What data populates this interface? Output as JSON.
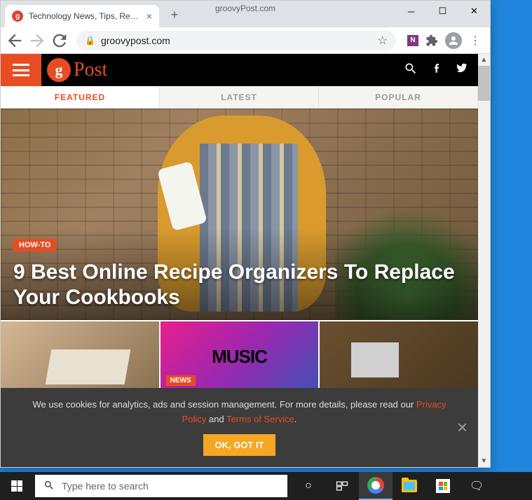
{
  "browser": {
    "tab_title": "Technology News, Tips, Reviews,",
    "overlay": "groovyPost.com",
    "url": "groovypost.com"
  },
  "site": {
    "logo_letter": "g",
    "logo_text": "Post"
  },
  "nav_tabs": {
    "featured": "FEATURED",
    "latest": "LATEST",
    "popular": "POPULAR"
  },
  "hero": {
    "category": "HOW-TO",
    "title": "9 Best Online Recipe Organizers To Replace Your Cookbooks"
  },
  "thumbs": {
    "news_tag": "NEWS",
    "music_text": "MUSIC"
  },
  "cookie": {
    "text_pre": "We use cookies for analytics, ads and session management. For more details, please read our ",
    "privacy": "Privacy Policy",
    "and": " and ",
    "terms": "Terms of Service",
    "period": ".",
    "button": "OK, GOT IT"
  },
  "taskbar": {
    "search_placeholder": "Type here to search"
  }
}
